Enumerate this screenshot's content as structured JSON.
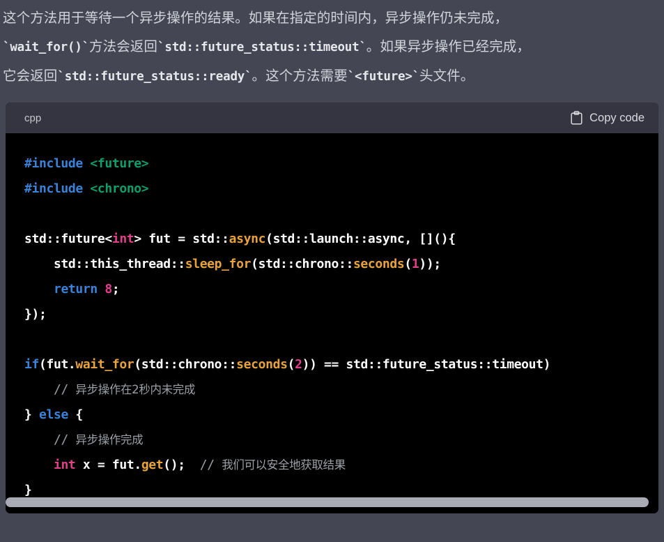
{
  "prose": {
    "lines": [
      {
        "segments": [
          {
            "type": "text",
            "text": "这个方法用于等待一个异步操作的结果。如果在指定的时间内，异步操作仍未完成，"
          }
        ]
      },
      {
        "segments": [
          {
            "type": "code",
            "text": "`wait_for()`"
          },
          {
            "type": "text",
            "text": "方法会返回"
          },
          {
            "type": "code",
            "text": "`std::future_status::timeout`"
          },
          {
            "type": "text",
            "text": "。如果异步操作已经完成，"
          }
        ]
      },
      {
        "segments": [
          {
            "type": "text",
            "text": "它会返回"
          },
          {
            "type": "code",
            "text": "`std::future_status::ready`"
          },
          {
            "type": "text",
            "text": "。这个方法需要"
          },
          {
            "type": "code",
            "text": "`<future>`"
          },
          {
            "type": "text",
            "text": "头文件。"
          }
        ]
      }
    ]
  },
  "code_block": {
    "language_label": "cpp",
    "copy_label": "Copy code",
    "copy_icon": "clipboard-icon",
    "scrollbar": {
      "orientation": "horizontal",
      "thumb_color": "#a8aab4"
    },
    "colors": {
      "header_bg": "#343541",
      "body_bg": "#000000",
      "keyword": "#3b82d9",
      "string": "#0f9e6e",
      "type": "#e0408a",
      "number": "#e0408a",
      "function": "#e8a33d",
      "comment": "#9aa0a6",
      "plain": "#ffffff"
    },
    "lines": [
      [
        {
          "t": "pre",
          "s": "#include "
        },
        {
          "t": "str",
          "s": "<future>"
        }
      ],
      [
        {
          "t": "pre",
          "s": "#include "
        },
        {
          "t": "str",
          "s": "<chrono>"
        }
      ],
      [],
      [
        {
          "t": "plain",
          "s": "std::future<"
        },
        {
          "t": "type",
          "s": "int"
        },
        {
          "t": "plain",
          "s": "> fut = std::"
        },
        {
          "t": "fn",
          "s": "async"
        },
        {
          "t": "plain",
          "s": "(std::launch::async, [](){"
        }
      ],
      [
        {
          "t": "plain",
          "s": "    std::this_thread::"
        },
        {
          "t": "fn",
          "s": "sleep_for"
        },
        {
          "t": "plain",
          "s": "(std::chrono::"
        },
        {
          "t": "fn",
          "s": "seconds"
        },
        {
          "t": "plain",
          "s": "("
        },
        {
          "t": "num",
          "s": "1"
        },
        {
          "t": "plain",
          "s": "));"
        }
      ],
      [
        {
          "t": "plain",
          "s": "    "
        },
        {
          "t": "kw",
          "s": "return"
        },
        {
          "t": "plain",
          "s": " "
        },
        {
          "t": "num",
          "s": "8"
        },
        {
          "t": "plain",
          "s": ";"
        }
      ],
      [
        {
          "t": "plain",
          "s": "});"
        }
      ],
      [],
      [
        {
          "t": "kw",
          "s": "if"
        },
        {
          "t": "plain",
          "s": "(fut."
        },
        {
          "t": "fn",
          "s": "wait_for"
        },
        {
          "t": "plain",
          "s": "(std::chrono::"
        },
        {
          "t": "fn",
          "s": "seconds"
        },
        {
          "t": "plain",
          "s": "("
        },
        {
          "t": "num",
          "s": "2"
        },
        {
          "t": "plain",
          "s": ")) == std::future_status::timeout)"
        }
      ],
      [
        {
          "t": "plain",
          "s": "    "
        },
        {
          "t": "cmt",
          "s": "// "
        },
        {
          "t": "cmt-cjk",
          "s": "异步操作在2秒内未完成"
        }
      ],
      [
        {
          "t": "plain",
          "s": "} "
        },
        {
          "t": "kw",
          "s": "else"
        },
        {
          "t": "plain",
          "s": " {"
        }
      ],
      [
        {
          "t": "plain",
          "s": "    "
        },
        {
          "t": "cmt",
          "s": "// "
        },
        {
          "t": "cmt-cjk",
          "s": "异步操作完成"
        }
      ],
      [
        {
          "t": "plain",
          "s": "    "
        },
        {
          "t": "type",
          "s": "int"
        },
        {
          "t": "plain",
          "s": " x = fut."
        },
        {
          "t": "fn",
          "s": "get"
        },
        {
          "t": "plain",
          "s": "();  "
        },
        {
          "t": "cmt",
          "s": "// "
        },
        {
          "t": "cmt-cjk",
          "s": "我们可以安全地获取结果"
        }
      ],
      [
        {
          "t": "plain",
          "s": "}"
        }
      ]
    ]
  }
}
